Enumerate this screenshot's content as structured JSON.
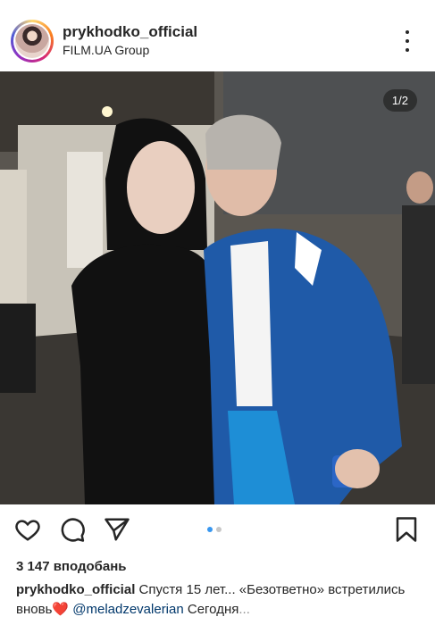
{
  "post": {
    "username": "prykhodko_official",
    "location": "FILM.UA Group",
    "counter": "1/2",
    "likes": "3 147 вподобань",
    "caption": {
      "user": "prykhodko_official",
      "text_1": " Спустя 15 лет... «Безответно» встретились вновь",
      "heart": "❤️",
      "mention": "@meladzevalerian",
      "text_2": " Сегодня",
      "more": "..."
    }
  },
  "icons": {
    "more": "more-options-icon",
    "like": "heart-icon",
    "comment": "comment-icon",
    "share": "send-icon",
    "save": "bookmark-icon"
  },
  "carousel": {
    "total": 2,
    "current": 1
  },
  "colors": {
    "accent": "#3897f0",
    "mention": "#00376b",
    "text": "#262626"
  }
}
